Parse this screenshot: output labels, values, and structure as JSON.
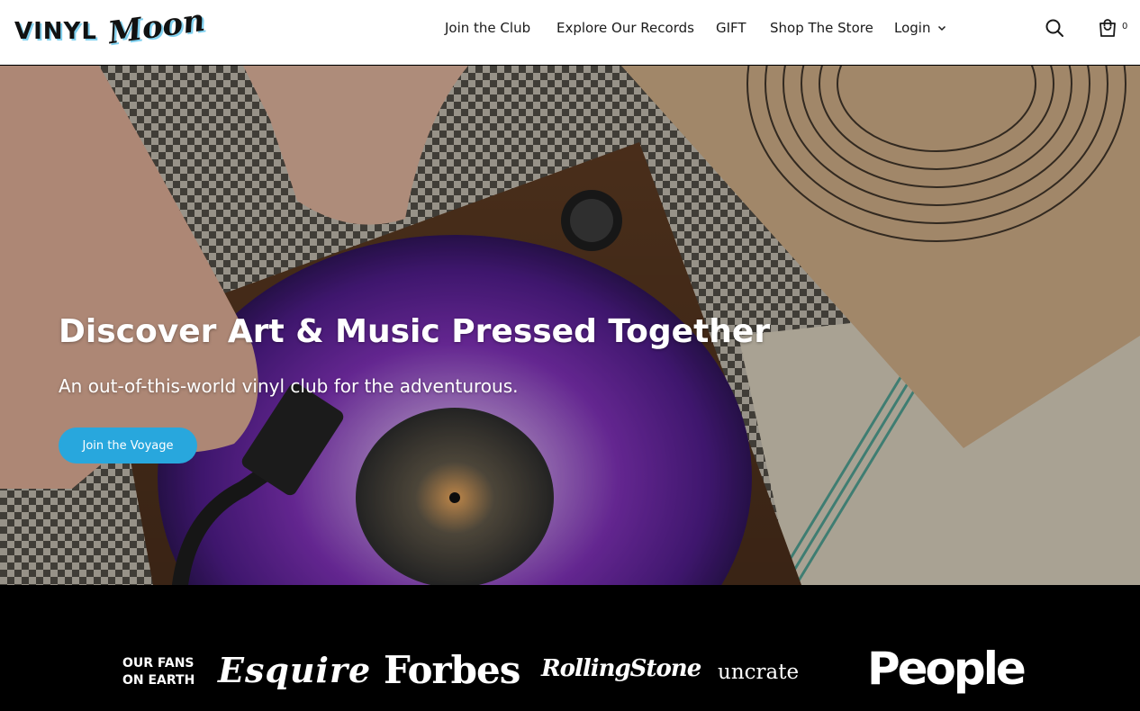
{
  "header": {
    "logo_text": "VINYL Moon",
    "nav": [
      {
        "label": "Join the Club"
      },
      {
        "label": "Explore Our Records"
      },
      {
        "label": "GIFT"
      },
      {
        "label": "Shop The Store"
      },
      {
        "label": "Login"
      }
    ],
    "search_icon": "search-icon",
    "cart_icon": "shopping-bag-icon",
    "cart_count": "0"
  },
  "hero": {
    "title": "Discover Art & Music Pressed Together",
    "subtitle": "An out-of-this-world vinyl club for the adventurous.",
    "cta_label": "Join the Voyage",
    "cta_color": "#28a7dd"
  },
  "press": {
    "label_line1": "OUR FANS",
    "label_line2": "ON EARTH",
    "logos": [
      "Esquire",
      "Forbes",
      "RollingStone",
      "uncrate",
      "People"
    ]
  },
  "colors": {
    "accent": "#28a7dd",
    "header_bg": "#ffffff",
    "press_bg": "#000000"
  }
}
